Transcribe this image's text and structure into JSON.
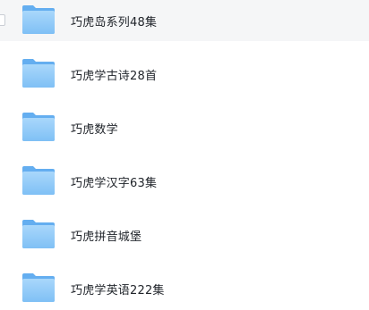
{
  "files": [
    {
      "name": "巧虎岛系列48集",
      "type": "folder",
      "icon": "folder-icon",
      "hovered": true,
      "checkbox_visible": true
    },
    {
      "name": "巧虎学古诗28首",
      "type": "folder",
      "icon": "folder-icon"
    },
    {
      "name": "巧虎数学",
      "type": "folder",
      "icon": "folder-icon"
    },
    {
      "name": "巧虎学汉字63集",
      "type": "folder",
      "icon": "folder-icon"
    },
    {
      "name": "巧虎拼音城堡",
      "type": "folder",
      "icon": "folder-icon"
    },
    {
      "name": "巧虎学英语222集",
      "type": "folder",
      "icon": "folder-icon"
    }
  ],
  "colors": {
    "folder_back": "#64aef0",
    "folder_front_top": "#a9d7fb",
    "folder_front_bottom": "#7fc0f5",
    "hover_bg": "#f5f6f7",
    "text": "#1f2329"
  }
}
